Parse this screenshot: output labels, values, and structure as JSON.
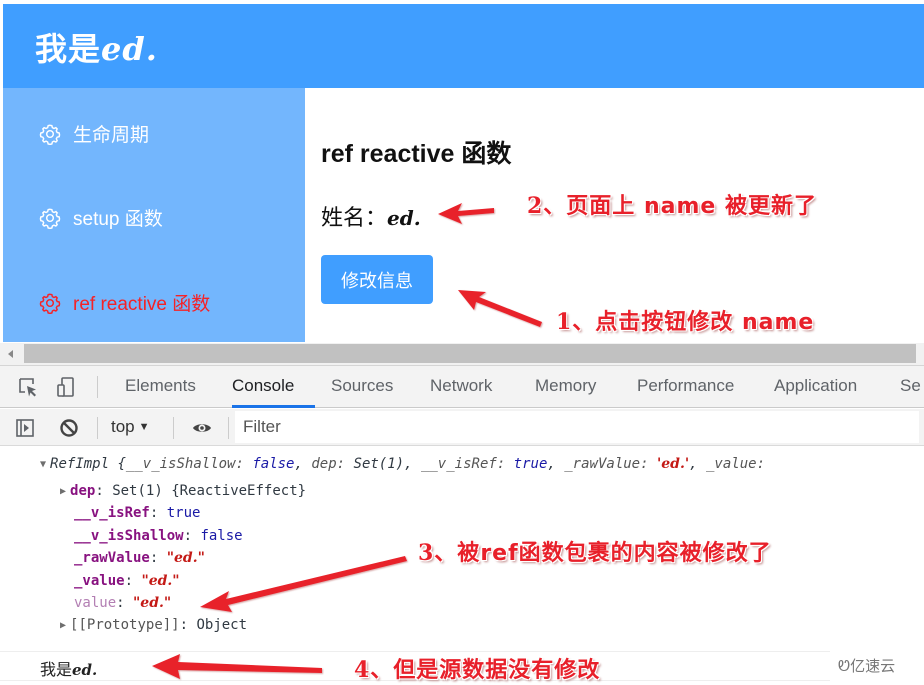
{
  "app": {
    "title_prefix": "我是",
    "title_value": "ed."
  },
  "sidebar": {
    "items": [
      {
        "label": "生命周期",
        "icon": "gear-icon",
        "active": false
      },
      {
        "label": "setup 函数",
        "icon": "gear-icon",
        "active": false
      },
      {
        "label": "ref reactive 函数",
        "icon": "gear-icon",
        "active": true
      }
    ]
  },
  "main": {
    "title": "ref reactive 函数",
    "name_label": "姓名：",
    "name_value": "ed.",
    "edit_button": "修改信息"
  },
  "devtools": {
    "tabs": [
      "Elements",
      "Console",
      "Sources",
      "Network",
      "Memory",
      "Performance",
      "Application",
      "Se"
    ],
    "active_tab": "Console",
    "context": "top",
    "filter_placeholder": "Filter"
  },
  "console": {
    "summary": {
      "class_name": "RefImpl",
      "open": " {",
      "k1": "__v_isShallow",
      "v1": "false",
      "k2": "dep",
      "v2": "Set(1)",
      "k3": "__v_isRef",
      "v3": "true",
      "k4": "_rawValue",
      "v4": "'ed.'",
      "k5": "_value",
      "sep": ": ",
      "comma": ", "
    },
    "props": [
      {
        "key": "dep",
        "value": "Set(1) {ReactiveEffect}"
      },
      {
        "key": "__v_isRef",
        "value": "true"
      },
      {
        "key": "__v_isShallow",
        "value": "false"
      },
      {
        "key": "_rawValue",
        "value": "\"ed.\""
      },
      {
        "key": "_value",
        "value": "\"ed.\""
      },
      {
        "key": "value",
        "value": "\"ed.\""
      },
      {
        "key": "[[Prototype]]",
        "value": "Object"
      }
    ],
    "log_prefix": "我是",
    "log_value": "ed."
  },
  "annotations": {
    "a1_text": "1、点击按钮修改 ",
    "a1_code": "name",
    "a2_text": "2、页面上 ",
    "a2_code": "name",
    "a2_tail": " 被更新了",
    "a3_text": "3、被",
    "a3_code": "ref",
    "a3_tail": "函数包裹的内容被修改了",
    "a4_text": "4、但是源数据没有修改"
  },
  "watermark": "亿速云",
  "colors": {
    "primary": "#409eff",
    "sidebar_bg": "#73b6fd",
    "active_menu": "#f52226",
    "annotation": "#e8202a"
  }
}
